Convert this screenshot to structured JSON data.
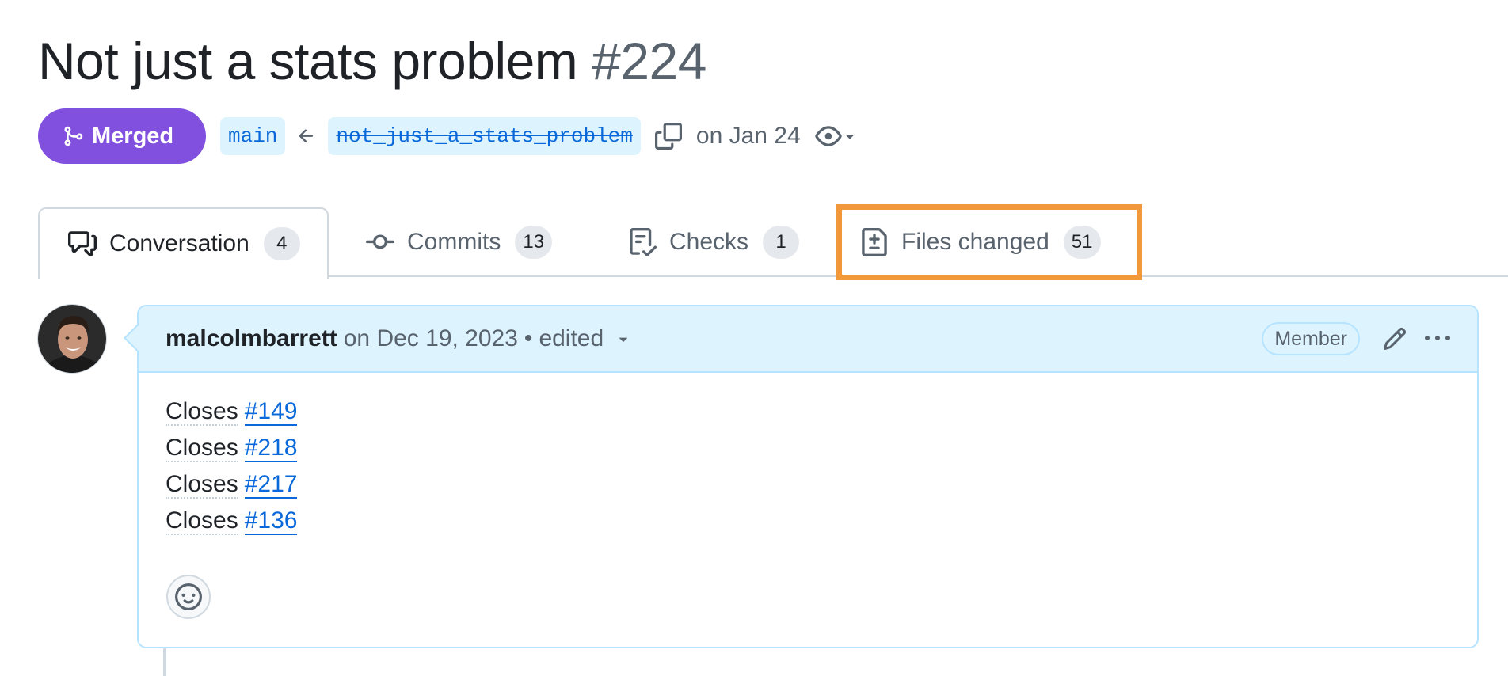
{
  "pr": {
    "title": "Not just a stats problem",
    "number": "#224",
    "status": "Merged",
    "base_branch": "main",
    "head_branch": "not_just_a_stats_problem",
    "merged_date": "on Jan 24"
  },
  "tabs": [
    {
      "label": "Conversation",
      "count": "4",
      "icon": "comment-discussion-icon",
      "active": true
    },
    {
      "label": "Commits",
      "count": "13",
      "icon": "git-commit-icon",
      "active": false
    },
    {
      "label": "Checks",
      "count": "1",
      "icon": "checklist-icon",
      "active": false
    },
    {
      "label": "Files changed",
      "count": "51",
      "icon": "file-diff-icon",
      "active": false,
      "highlighted": true
    }
  ],
  "comment": {
    "author": "malcolmbarrett",
    "date": "on Dec 19, 2023",
    "separator": "•",
    "edited": "edited",
    "role": "Member",
    "lines": [
      {
        "word": "Closes",
        "link": "#149"
      },
      {
        "word": "Closes",
        "link": "#218"
      },
      {
        "word": "Closes",
        "link": "#217"
      },
      {
        "word": "Closes",
        "link": "#136"
      }
    ]
  },
  "colors": {
    "merged": "#8250df",
    "link": "#0969da",
    "highlight_box": "#f0983a",
    "comment_header_bg": "#ddf4ff"
  }
}
